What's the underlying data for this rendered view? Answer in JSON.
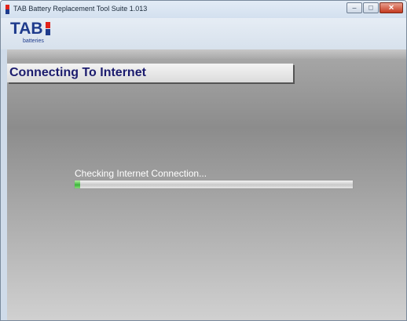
{
  "window": {
    "title": "TAB Battery Replacement Tool Suite 1.013",
    "controls": {
      "minimize_icon": "minimize-icon",
      "maximize_icon": "maximize-icon",
      "close_icon": "close-icon"
    }
  },
  "logo": {
    "main": "TAB",
    "sub": "batteries",
    "brand_red": "#e2231a",
    "brand_blue": "#1e3b8c"
  },
  "page": {
    "title": "Connecting To Internet"
  },
  "status": {
    "message": "Checking Internet Connection...",
    "progress": 0.02,
    "progress_color": "#3cb43c"
  }
}
